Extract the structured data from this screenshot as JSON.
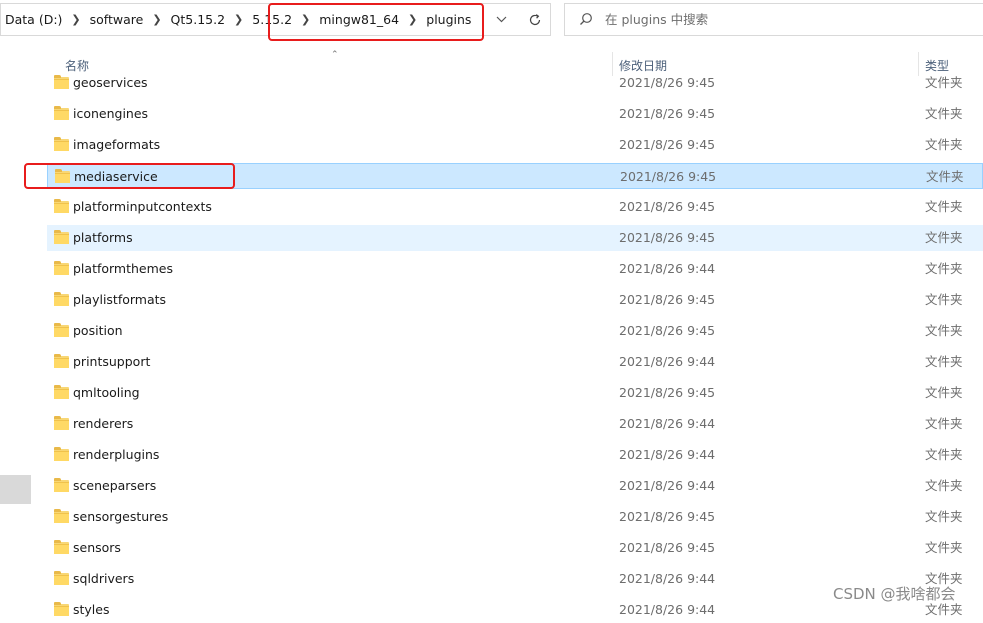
{
  "breadcrumb": [
    "Data (D:)",
    "software",
    "Qt5.15.2",
    "5.15.2",
    "mingw81_64",
    "plugins"
  ],
  "search": {
    "placeholder": "在 plugins 中搜索"
  },
  "columns": {
    "name": "名称",
    "date": "修改日期",
    "type": "类型"
  },
  "files": [
    {
      "name": "geoservices",
      "date": "2021/8/26 9:45",
      "type": "文件夹"
    },
    {
      "name": "iconengines",
      "date": "2021/8/26 9:45",
      "type": "文件夹"
    },
    {
      "name": "imageformats",
      "date": "2021/8/26 9:45",
      "type": "文件夹"
    },
    {
      "name": "mediaservice",
      "date": "2021/8/26 9:45",
      "type": "文件夹"
    },
    {
      "name": "platforminputcontexts",
      "date": "2021/8/26 9:45",
      "type": "文件夹"
    },
    {
      "name": "platforms",
      "date": "2021/8/26 9:45",
      "type": "文件夹"
    },
    {
      "name": "platformthemes",
      "date": "2021/8/26 9:44",
      "type": "文件夹"
    },
    {
      "name": "playlistformats",
      "date": "2021/8/26 9:45",
      "type": "文件夹"
    },
    {
      "name": "position",
      "date": "2021/8/26 9:45",
      "type": "文件夹"
    },
    {
      "name": "printsupport",
      "date": "2021/8/26 9:44",
      "type": "文件夹"
    },
    {
      "name": "qmltooling",
      "date": "2021/8/26 9:45",
      "type": "文件夹"
    },
    {
      "name": "renderers",
      "date": "2021/8/26 9:44",
      "type": "文件夹"
    },
    {
      "name": "renderplugins",
      "date": "2021/8/26 9:44",
      "type": "文件夹"
    },
    {
      "name": "sceneparsers",
      "date": "2021/8/26 9:44",
      "type": "文件夹"
    },
    {
      "name": "sensorgestures",
      "date": "2021/8/26 9:45",
      "type": "文件夹"
    },
    {
      "name": "sensors",
      "date": "2021/8/26 9:45",
      "type": "文件夹"
    },
    {
      "name": "sqldrivers",
      "date": "2021/8/26 9:44",
      "type": "文件夹"
    },
    {
      "name": "styles",
      "date": "2021/8/26 9:44",
      "type": "文件夹"
    }
  ],
  "selected_file": "mediaservice",
  "hovered_file": "platforms",
  "watermark": "CSDN @我啥都会",
  "colors": {
    "selected": "#cce8ff",
    "hover": "#e5f3ff",
    "highlight_box": "#e81c1c"
  }
}
